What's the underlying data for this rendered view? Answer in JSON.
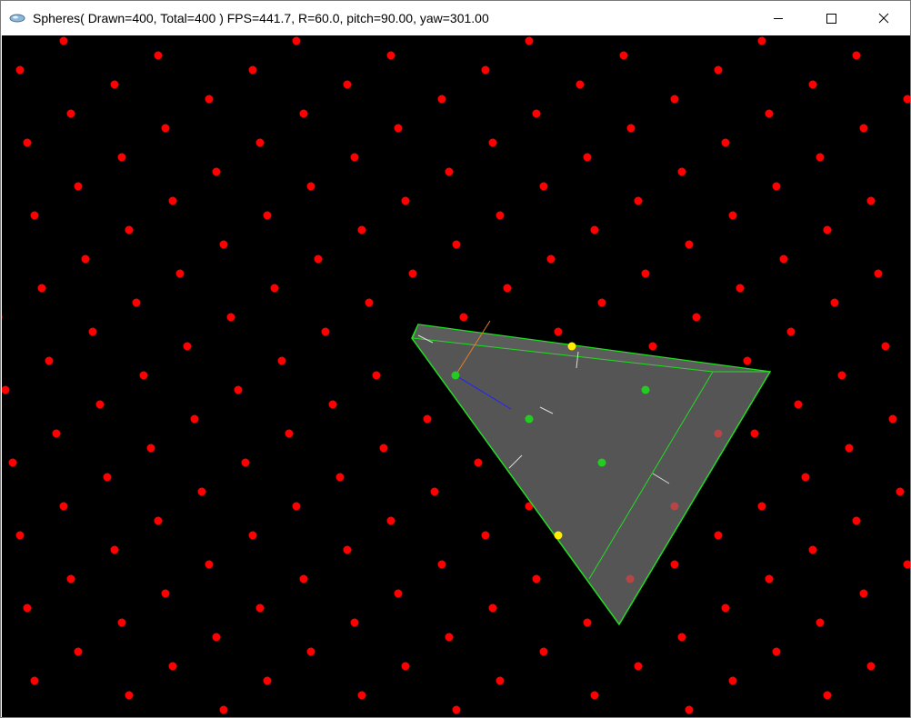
{
  "window": {
    "title": "Spheres( Drawn=400, Total=400 ) FPS=441.7, R=60.0, pitch=90.00, yaw=301.00",
    "controls": {
      "minimize_icon": "minimize-icon",
      "maximize_icon": "maximize-icon",
      "close_icon": "close-icon"
    }
  },
  "scene": {
    "background_color": "#000000",
    "sphere_color": "#ff0000",
    "sphere_dim_color": "#b84545",
    "inside_color": "#22cc22",
    "edge_color": "#ffee00",
    "frustum_fill": "#555555",
    "frustum_line": "#22dd22",
    "axis_orange": "#e08020",
    "axis_blue": "#2222ff"
  }
}
